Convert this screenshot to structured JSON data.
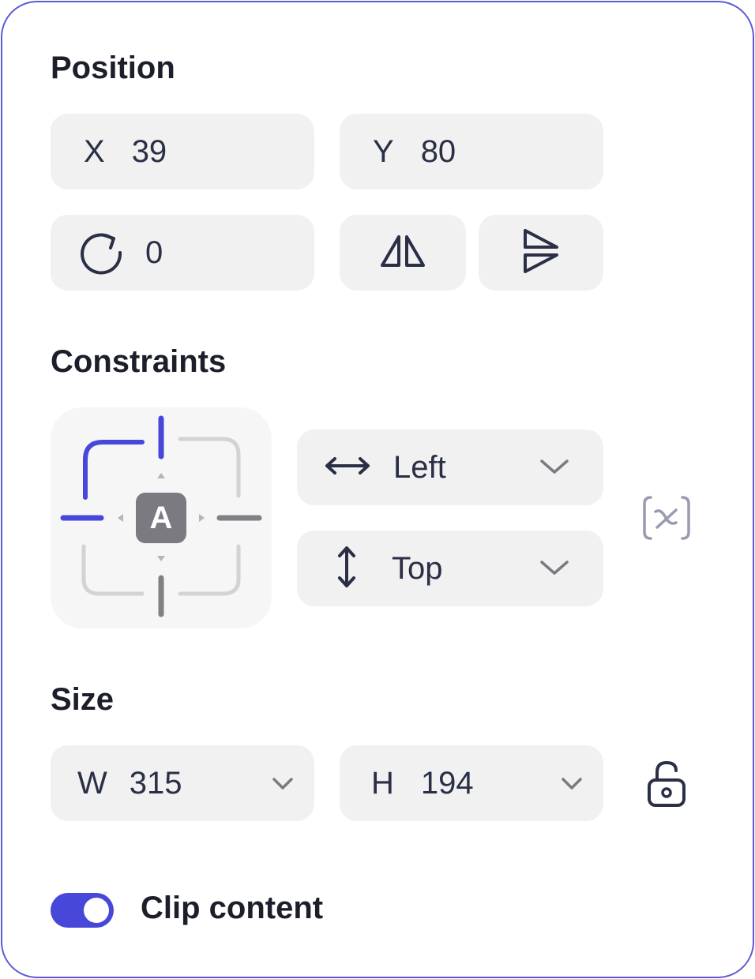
{
  "position": {
    "title": "Position",
    "x": {
      "label": "X",
      "value": "39"
    },
    "y": {
      "label": "Y",
      "value": "80"
    },
    "rotation": {
      "value": "0",
      "icon": "rotate-icon"
    },
    "flip_horizontal_icon": "flip-horizontal-icon",
    "flip_vertical_icon": "flip-vertical-icon"
  },
  "constraints": {
    "title": "Constraints",
    "widget_center_label": "A",
    "horizontal": {
      "value": "Left",
      "icon": "horizontal-arrow-icon"
    },
    "vertical": {
      "value": "Top",
      "icon": "vertical-arrow-icon"
    },
    "variable_icon": "variable-icon"
  },
  "size": {
    "title": "Size",
    "width": {
      "label": "W",
      "value": "315"
    },
    "height": {
      "label": "H",
      "value": "194"
    },
    "lock_icon": "unlock-icon"
  },
  "clip": {
    "label": "Clip content",
    "enabled": true
  },
  "colors": {
    "accent": "#4747d9",
    "field_bg": "#f1f1f2",
    "border": "#5b5bd6"
  }
}
